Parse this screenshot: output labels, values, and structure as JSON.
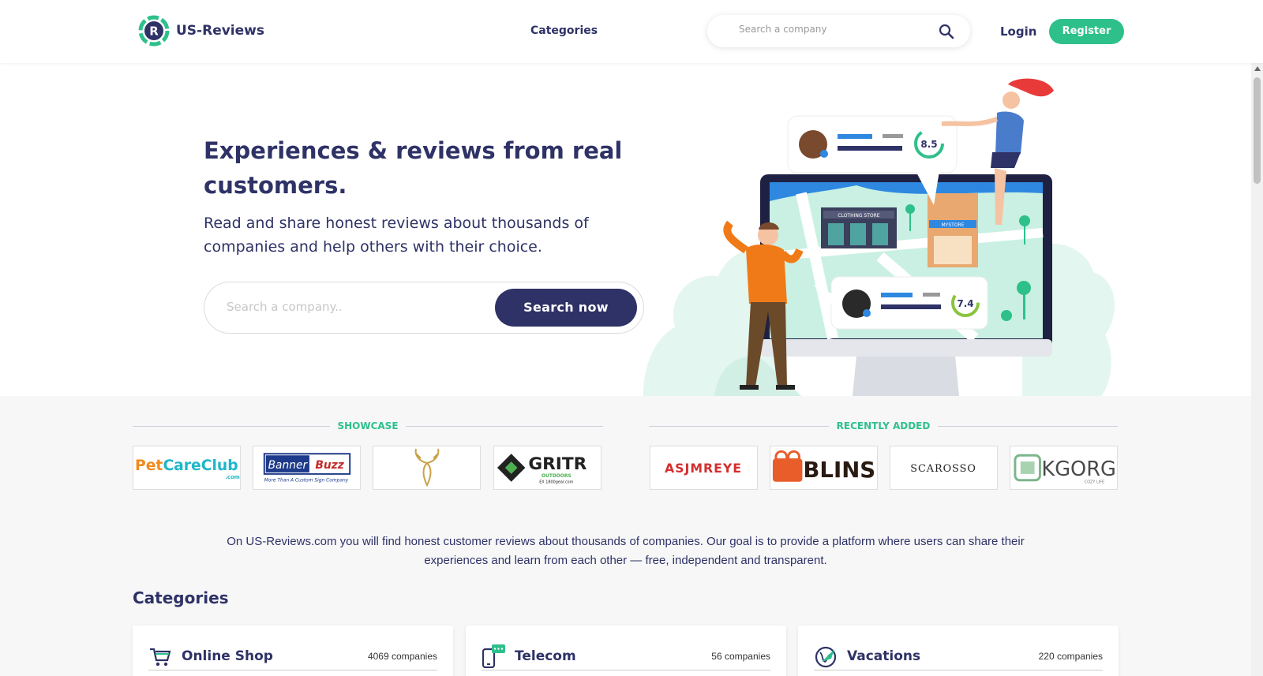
{
  "header": {
    "brand": "US-Reviews",
    "nav_categories": "Categories",
    "search_placeholder": "Search a company",
    "login": "Login",
    "register": "Register"
  },
  "hero": {
    "title": "Experiences & reviews from real customers.",
    "subtitle": "Read and share honest reviews about thousands of companies and help others with their choice.",
    "search_placeholder": "Search a company..",
    "search_button": "Search now",
    "illustration": {
      "store_sign_1": "CLOTHING STORE",
      "store_sign_2": "MYSTORE",
      "rating_1": "8.5",
      "rating_2": "7.4"
    }
  },
  "showcase": {
    "label": "SHOWCASE",
    "brands": [
      "PetCareClub",
      "BannerBuzz",
      "deer-logo",
      "GRITR"
    ],
    "petcare_sub": ".com",
    "bannerbuzz_tag": "More Than A Custom Sign Company",
    "gritr_sub": "OUTDOORS",
    "gritr_sub2": "EX 1800gear.com"
  },
  "recently_added": {
    "label": "RECENTLY ADDED",
    "brands": [
      "ASJMREYE",
      "BLINS",
      "SCAROSSO",
      "KGORGE"
    ],
    "kgorge_sub": "COZY LIFE"
  },
  "intro_text": "On US-Reviews.com you will find honest customer reviews about thousands of companies. Our goal is to provide a platform where users can share their experiences and learn from each other — free, independent and transparent.",
  "categories": {
    "title": "Categories",
    "items": [
      {
        "name": "Online Shop",
        "count": "4069 companies",
        "icon": "cart-icon"
      },
      {
        "name": "Telecom",
        "count": "56 companies",
        "icon": "phone-icon"
      },
      {
        "name": "Vacations",
        "count": "220 companies",
        "icon": "globe-plane-icon"
      }
    ]
  },
  "colors": {
    "primary": "#2e3266",
    "accent": "#2ec08b",
    "background": "#f7f7f8"
  }
}
